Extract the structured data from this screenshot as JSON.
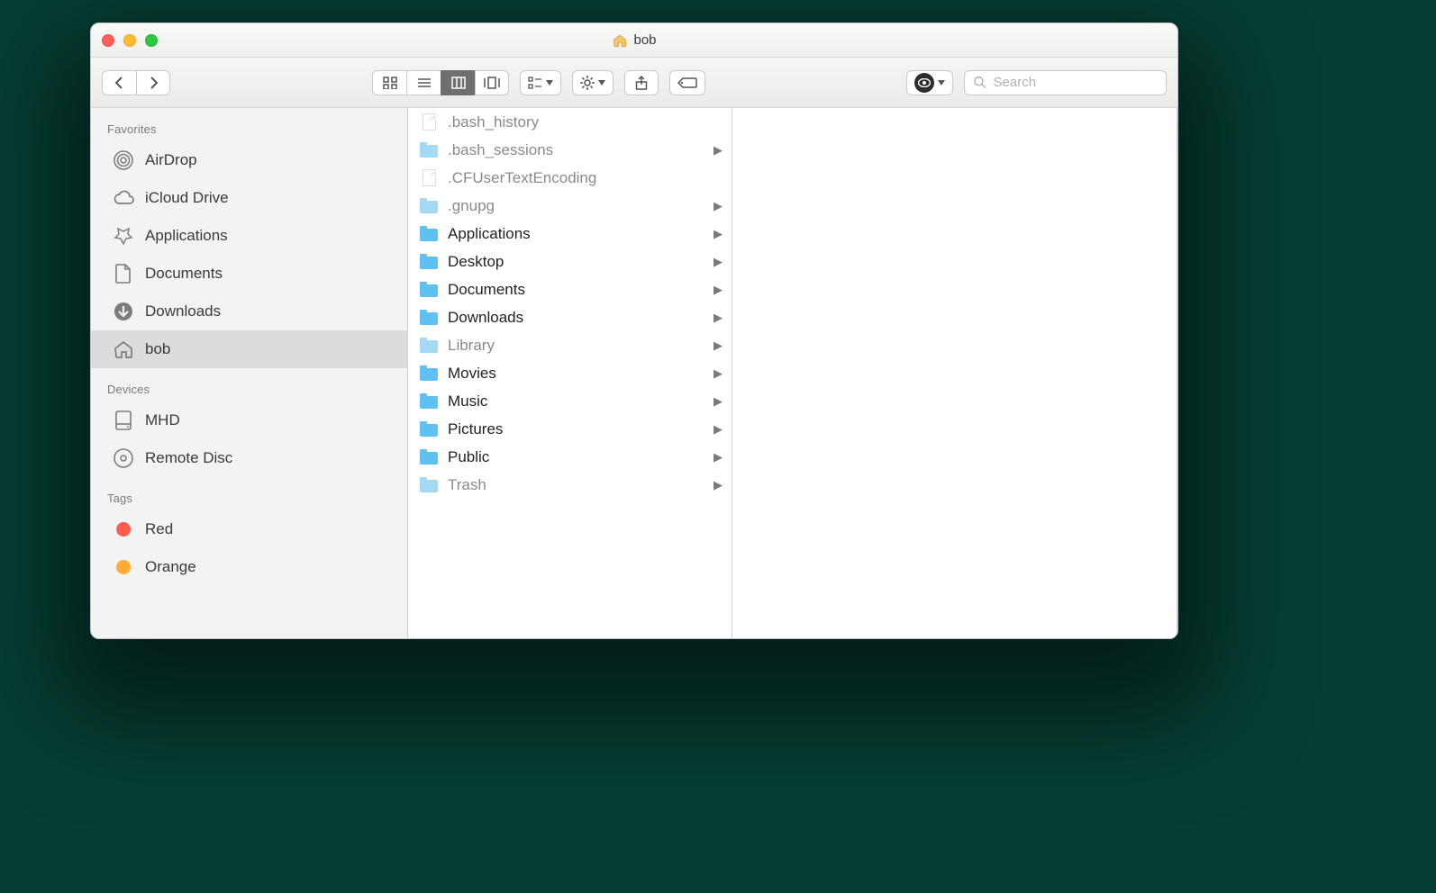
{
  "window": {
    "title": "bob"
  },
  "toolbar": {
    "view_active": "columns",
    "search_placeholder": "Search"
  },
  "sidebar": {
    "sections": [
      {
        "title": "Favorites",
        "items": [
          {
            "id": "airdrop",
            "label": "AirDrop",
            "icon": "airdrop"
          },
          {
            "id": "icloud",
            "label": "iCloud Drive",
            "icon": "cloud"
          },
          {
            "id": "applications",
            "label": "Applications",
            "icon": "applications"
          },
          {
            "id": "documents",
            "label": "Documents",
            "icon": "document"
          },
          {
            "id": "downloads",
            "label": "Downloads",
            "icon": "downloads"
          },
          {
            "id": "bob",
            "label": "bob",
            "icon": "home",
            "selected": true
          }
        ]
      },
      {
        "title": "Devices",
        "items": [
          {
            "id": "mhd",
            "label": "MHD",
            "icon": "hdd"
          },
          {
            "id": "remotedisc",
            "label": "Remote Disc",
            "icon": "disc"
          }
        ]
      },
      {
        "title": "Tags",
        "items": [
          {
            "id": "tag-red",
            "label": "Red",
            "icon": "tag",
            "color": "red"
          },
          {
            "id": "tag-orange",
            "label": "Orange",
            "icon": "tag",
            "color": "orange"
          }
        ]
      }
    ]
  },
  "column1": [
    {
      "name": ".bash_history",
      "type": "file",
      "dim": true
    },
    {
      "name": ".bash_sessions",
      "type": "folder",
      "dim": true,
      "has_children": true
    },
    {
      "name": ".CFUserTextEncoding",
      "type": "file",
      "dim": true
    },
    {
      "name": ".gnupg",
      "type": "folder",
      "dim": true,
      "has_children": true
    },
    {
      "name": "Applications",
      "type": "folder",
      "dim": false,
      "has_children": true
    },
    {
      "name": "Desktop",
      "type": "folder",
      "dim": false,
      "has_children": true
    },
    {
      "name": "Documents",
      "type": "folder",
      "dim": false,
      "has_children": true
    },
    {
      "name": "Downloads",
      "type": "folder",
      "dim": false,
      "has_children": true
    },
    {
      "name": "Library",
      "type": "folder",
      "dim": true,
      "has_children": true
    },
    {
      "name": "Movies",
      "type": "folder",
      "dim": false,
      "has_children": true
    },
    {
      "name": "Music",
      "type": "folder",
      "dim": false,
      "has_children": true
    },
    {
      "name": "Pictures",
      "type": "folder",
      "dim": false,
      "has_children": true
    },
    {
      "name": "Public",
      "type": "folder",
      "dim": false,
      "has_children": true
    },
    {
      "name": "Trash",
      "type": "folder",
      "dim": true,
      "has_children": true
    }
  ]
}
